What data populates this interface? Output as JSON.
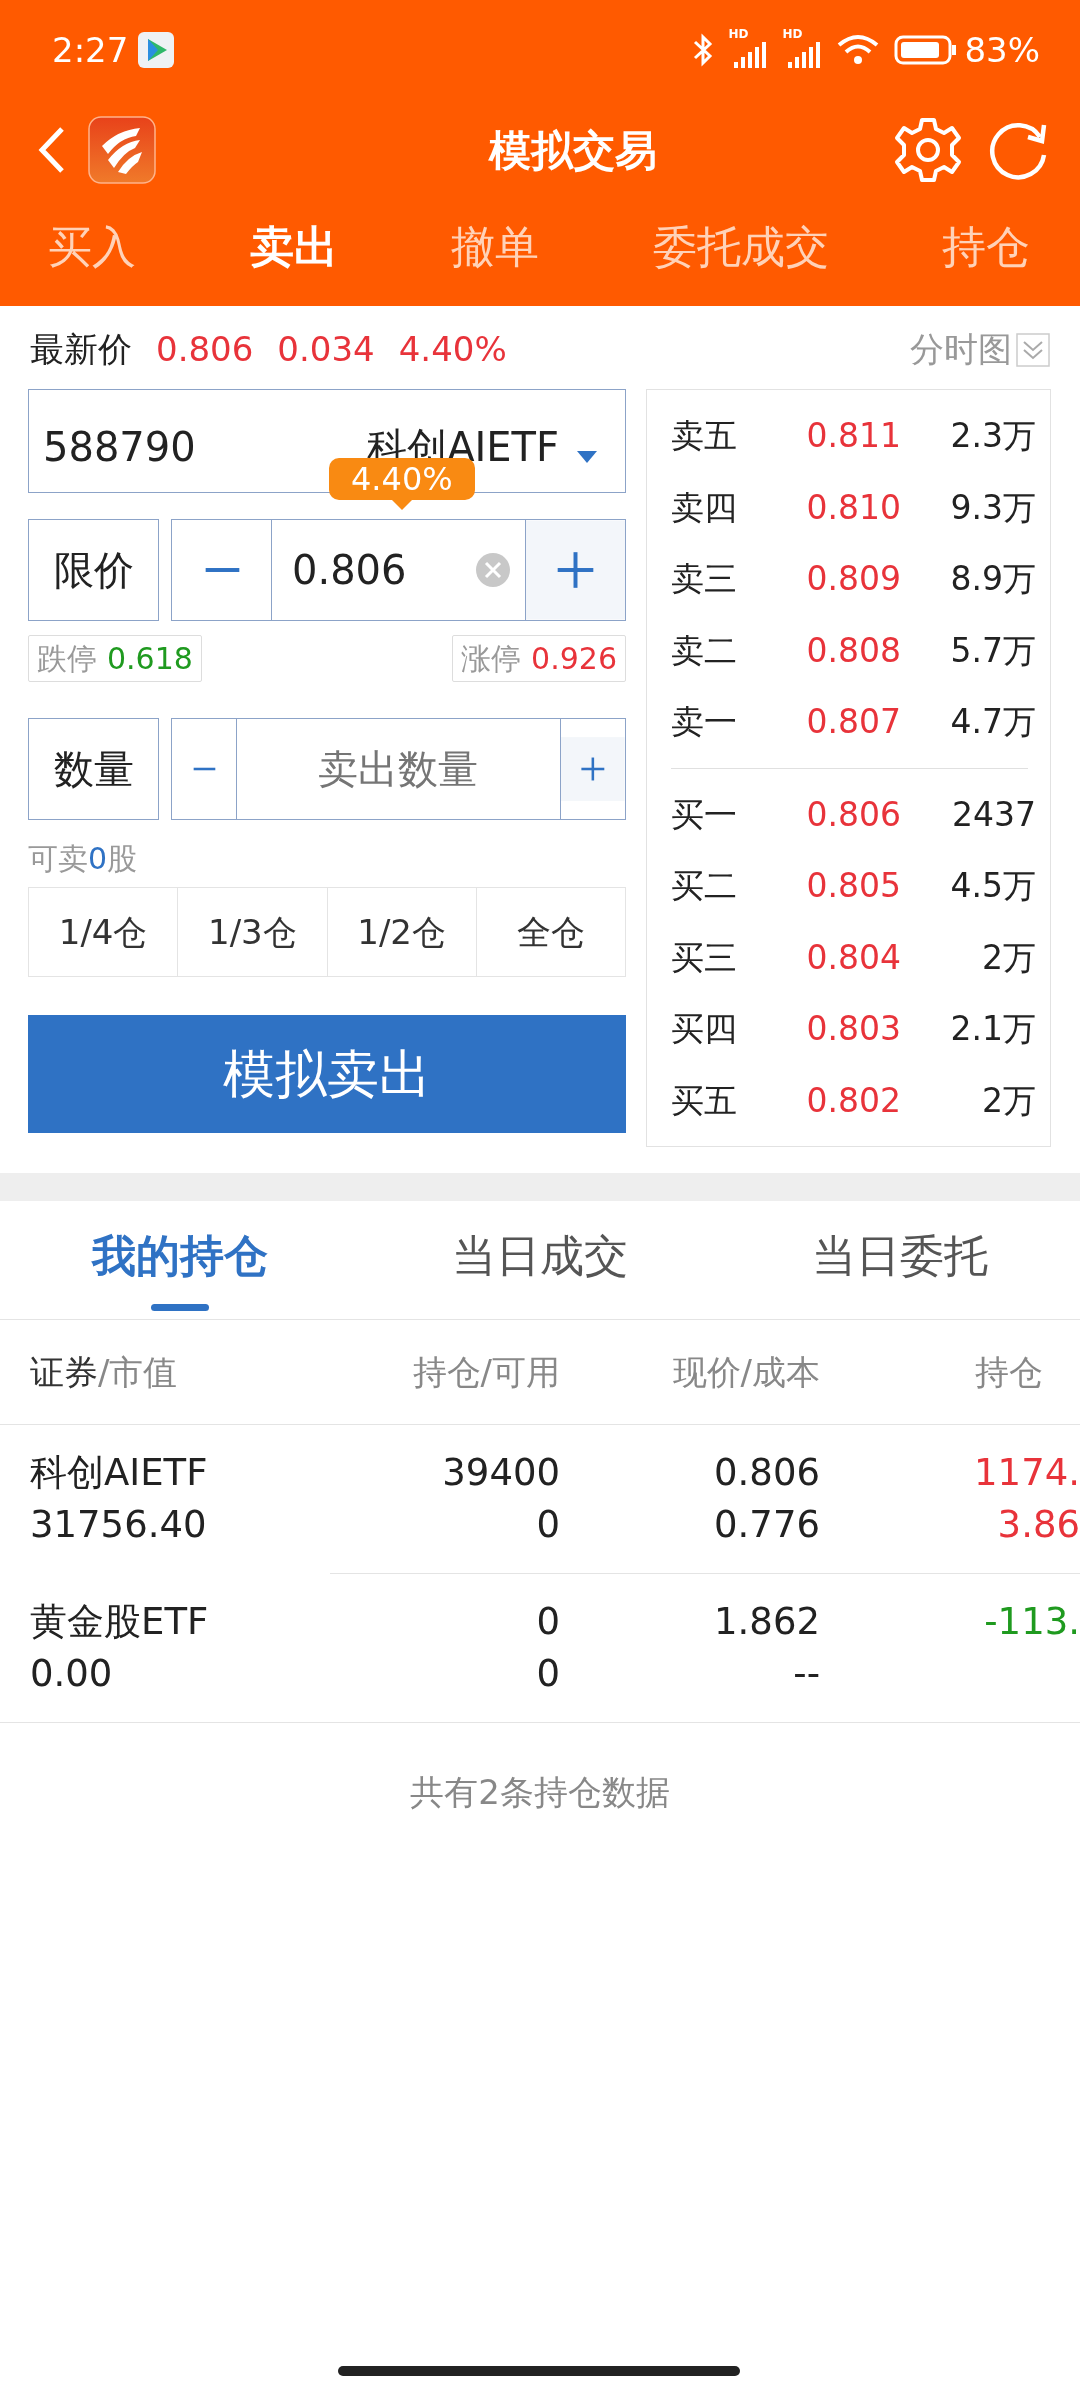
{
  "status_bar": {
    "time": "2:27",
    "network_labels": [
      "HD",
      "HD"
    ],
    "battery_text": "83%"
  },
  "nav": {
    "title": "模拟交易"
  },
  "tabs": [
    {
      "label": "买入",
      "selected": false
    },
    {
      "label": "卖出",
      "selected": true
    },
    {
      "label": "撤单",
      "selected": false
    },
    {
      "label": "委托成交",
      "selected": false
    },
    {
      "label": "持仓",
      "selected": false
    }
  ],
  "quote": {
    "label": "最新价",
    "price": "0.806",
    "change": "0.034",
    "percent": "4.40%",
    "chart_link": "分时图"
  },
  "stock": {
    "code": "588790",
    "name": "科创AIETF",
    "tooltip": "4.40%"
  },
  "price_field": {
    "label": "限价",
    "value": "0.806"
  },
  "limits": {
    "down_label": "跌停",
    "down_value": "0.618",
    "up_label": "涨停",
    "up_value": "0.926"
  },
  "quantity_field": {
    "label": "数量",
    "placeholder": "卖出数量"
  },
  "available": {
    "prefix": "可卖",
    "count": "0",
    "suffix": "股"
  },
  "fractions": [
    "1/4仓",
    "1/3仓",
    "1/2仓",
    "全仓"
  ],
  "submit": "模拟卖出",
  "order_book": {
    "asks": [
      {
        "label": "卖五",
        "price": "0.811",
        "volume": "2.3万"
      },
      {
        "label": "卖四",
        "price": "0.810",
        "volume": "9.3万"
      },
      {
        "label": "卖三",
        "price": "0.809",
        "volume": "8.9万"
      },
      {
        "label": "卖二",
        "price": "0.808",
        "volume": "5.7万"
      },
      {
        "label": "卖一",
        "price": "0.807",
        "volume": "4.7万"
      }
    ],
    "bids": [
      {
        "label": "买一",
        "price": "0.806",
        "volume": "2437"
      },
      {
        "label": "买二",
        "price": "0.805",
        "volume": "4.5万"
      },
      {
        "label": "买三",
        "price": "0.804",
        "volume": "2万"
      },
      {
        "label": "买四",
        "price": "0.803",
        "volume": "2.1万"
      },
      {
        "label": "买五",
        "price": "0.802",
        "volume": "2万"
      }
    ]
  },
  "position_tabs": [
    {
      "label": "我的持仓",
      "selected": true
    },
    {
      "label": "当日成交",
      "selected": false
    },
    {
      "label": "当日委托",
      "selected": false
    }
  ],
  "table": {
    "columns": [
      {
        "label": "证券",
        "sub": "/市值"
      },
      {
        "label": "持仓/可用"
      },
      {
        "label": "现价/成本"
      },
      {
        "label": "持仓"
      }
    ],
    "rows": [
      {
        "name": "科创AIETF",
        "value": "31756.40",
        "holding": "39400",
        "available": "0",
        "price": "0.806",
        "cost": "0.776",
        "pnl": "1174.",
        "pnl_pct": "3.86",
        "color": "#e8333a"
      },
      {
        "name": "黄金股ETF",
        "value": "0.00",
        "holding": "0",
        "available": "0",
        "price": "1.862",
        "cost": "--",
        "pnl": "-113.",
        "color": "#1f9a1f"
      }
    ]
  },
  "footer": "共有2条持仓数据"
}
